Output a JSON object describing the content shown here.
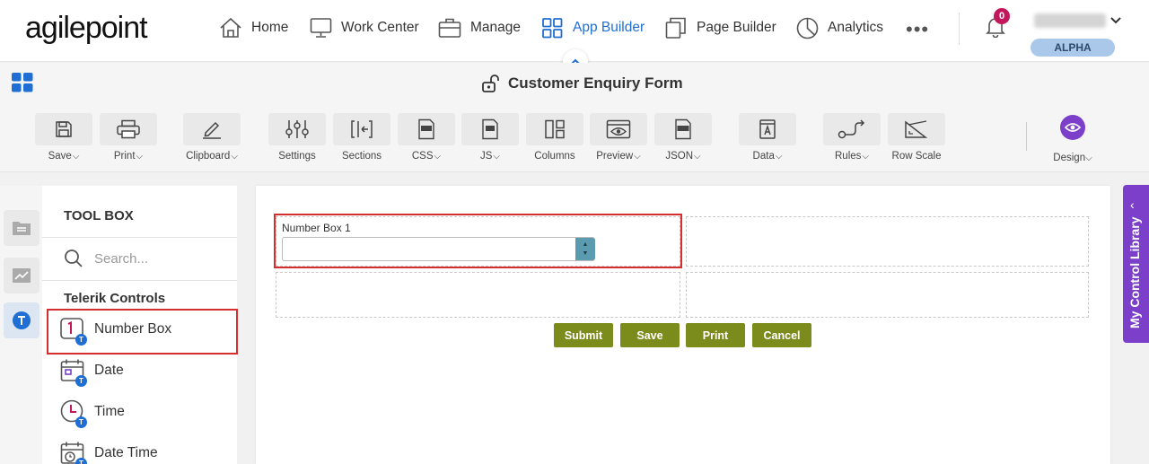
{
  "brand": {
    "logo_text": "agilepoint"
  },
  "topnav": {
    "items": [
      {
        "label": "Home",
        "icon": "home-icon"
      },
      {
        "label": "Work Center",
        "icon": "monitor-icon"
      },
      {
        "label": "Manage",
        "icon": "briefcase-icon"
      },
      {
        "label": "App Builder",
        "icon": "app-grid-icon",
        "active": true
      },
      {
        "label": "Page Builder",
        "icon": "pages-icon"
      },
      {
        "label": "Analytics",
        "icon": "pie-chart-icon"
      }
    ],
    "more": "•••",
    "notifications_count": "0",
    "env_badge": "ALPHA"
  },
  "titlebar": {
    "form_title": "Customer Enquiry Form"
  },
  "toolbar": {
    "tools": [
      {
        "label": "Save",
        "dropdown": true
      },
      {
        "label": "Print",
        "dropdown": true
      },
      {
        "label": "Clipboard",
        "dropdown": true
      },
      {
        "label": "Settings",
        "dropdown": false
      },
      {
        "label": "Sections",
        "dropdown": false
      },
      {
        "label": "CSS",
        "dropdown": true
      },
      {
        "label": "JS",
        "dropdown": true
      },
      {
        "label": "Columns",
        "dropdown": false
      },
      {
        "label": "Preview",
        "dropdown": true
      },
      {
        "label": "JSON",
        "dropdown": true
      },
      {
        "label": "Data",
        "dropdown": true
      },
      {
        "label": "Rules",
        "dropdown": true
      },
      {
        "label": "Row Scale",
        "dropdown": false
      }
    ],
    "design_label": "Design",
    "caret": "⌵"
  },
  "toolbox": {
    "title": "TOOL BOX",
    "search_placeholder": "Search...",
    "section": "Telerik Controls",
    "controls": [
      {
        "label": "Number Box",
        "icon": "number-box-icon"
      },
      {
        "label": "Date",
        "icon": "calendar-icon"
      },
      {
        "label": "Time",
        "icon": "clock-icon"
      },
      {
        "label": "Date Time",
        "icon": "calendar-clock-icon"
      }
    ],
    "badge": "T"
  },
  "form": {
    "field_label": "Number Box 1",
    "field_value": "",
    "spin_up": "▲",
    "spin_down": "▼",
    "buttons": [
      {
        "label": "Submit"
      },
      {
        "label": "Save"
      },
      {
        "label": "Print"
      },
      {
        "label": "Cancel"
      }
    ]
  },
  "right_tab": {
    "label": "My Control Library",
    "chevron": "‹"
  },
  "colors": {
    "accent_blue": "#1f6ed4",
    "purple": "#7b3fc9",
    "button_olive": "#7b8c1c",
    "highlight_red": "#d32f2f"
  }
}
